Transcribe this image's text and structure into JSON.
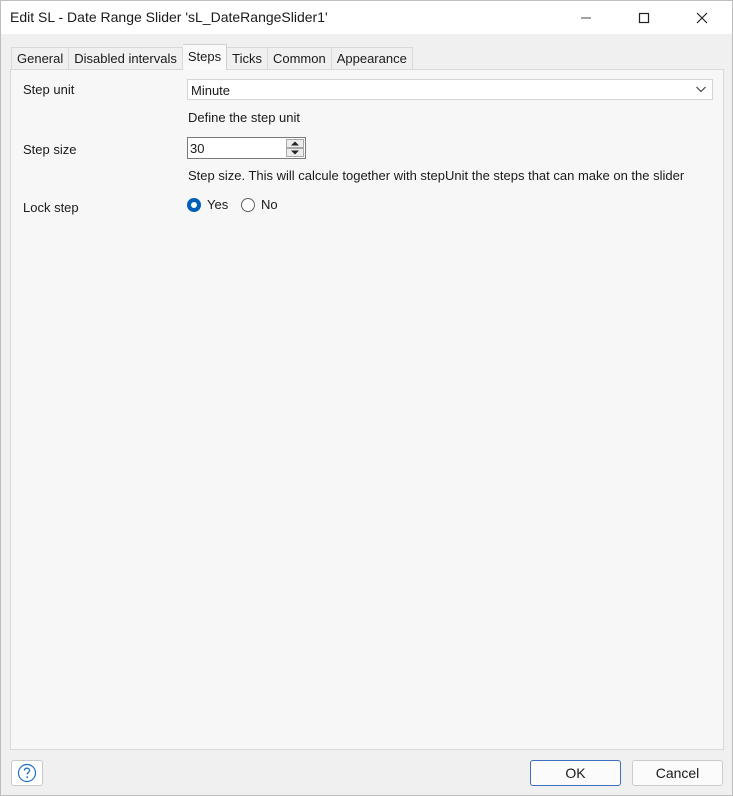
{
  "window": {
    "title": "Edit SL - Date Range Slider 'sL_DateRangeSlider1'"
  },
  "tabs": [
    {
      "label": "General",
      "active": false
    },
    {
      "label": "Disabled intervals",
      "active": false
    },
    {
      "label": "Steps",
      "active": true
    },
    {
      "label": "Ticks",
      "active": false
    },
    {
      "label": "Common",
      "active": false
    },
    {
      "label": "Appearance",
      "active": false
    }
  ],
  "steps": {
    "step_unit": {
      "label": "Step unit",
      "value": "Minute",
      "help": "Define the step unit"
    },
    "step_size": {
      "label": "Step size",
      "value": "30",
      "help": "Step size.  This will calcule together with stepUnit the steps that can make on the slider"
    },
    "lock_step": {
      "label": "Lock step",
      "options": [
        {
          "label": "Yes",
          "checked": true
        },
        {
          "label": "No",
          "checked": false
        }
      ]
    }
  },
  "footer": {
    "ok_label": "OK",
    "cancel_label": "Cancel"
  },
  "colors": {
    "accent": "#005fb8",
    "ok_border": "#3c6fbf"
  }
}
